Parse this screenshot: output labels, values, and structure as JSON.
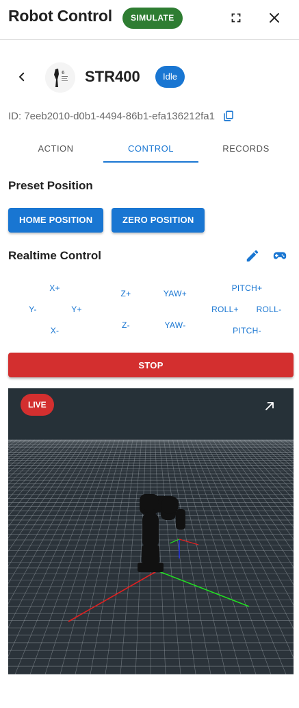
{
  "header": {
    "title": "Robot Control",
    "mode_badge": "SIMULATE",
    "icons": [
      "fullscreen-icon",
      "close-icon"
    ]
  },
  "robot": {
    "name": "STR400",
    "status": "Idle",
    "id_label": "ID: 7eeb2010-d0b1-4494-86b1-efa136212fa1"
  },
  "tabs": [
    {
      "label": "ACTION",
      "active": false
    },
    {
      "label": "CONTROL",
      "active": true
    },
    {
      "label": "RECORDS",
      "active": false
    }
  ],
  "preset": {
    "title": "Preset Position",
    "home_label": "HOME POSITION",
    "zero_label": "ZERO POSITION"
  },
  "realtime": {
    "title": "Realtime Control",
    "jog": {
      "x_plus": "X+",
      "x_minus": "X-",
      "y_minus": "Y-",
      "y_plus": "Y+",
      "z_plus": "Z+",
      "z_minus": "Z-",
      "yaw_plus": "YAW+",
      "yaw_minus": "YAW-",
      "pitch_plus": "PITCH+",
      "pitch_minus": "PITCH-",
      "roll_plus": "ROLL+",
      "roll_minus": "ROLL-"
    },
    "stop_label": "STOP"
  },
  "viewer": {
    "live_label": "LIVE"
  },
  "colors": {
    "primary": "#1976d2",
    "success": "#2e7d32",
    "danger": "#d32f2f",
    "viewport_bg": "#263138"
  }
}
